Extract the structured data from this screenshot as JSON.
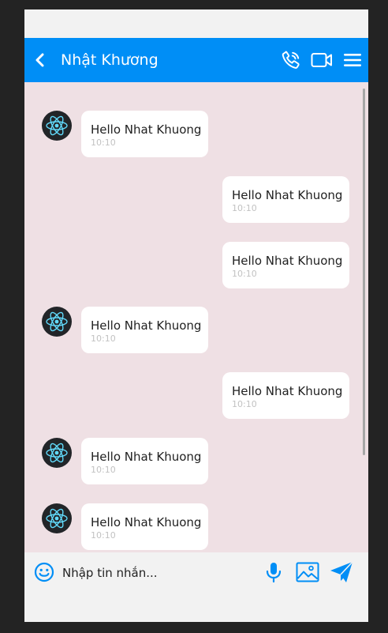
{
  "header": {
    "title": "Nhật Khương",
    "icons": [
      "back-chevron-icon",
      "phone-icon",
      "video-camera-icon",
      "menu-icon"
    ]
  },
  "messages": [
    {
      "side": "received",
      "text": "Hello Nhat Khuong",
      "time": "10:10"
    },
    {
      "side": "sent",
      "text": "Hello Nhat Khuong",
      "time": "10:10"
    },
    {
      "side": "sent",
      "text": "Hello Nhat Khuong",
      "time": "10:10"
    },
    {
      "side": "received",
      "text": "Hello Nhat Khuong",
      "time": "10:10"
    },
    {
      "side": "sent",
      "text": "Hello Nhat Khuong",
      "time": "10:10"
    },
    {
      "side": "received",
      "text": "Hello Nhat Khuong",
      "time": "10:10"
    },
    {
      "side": "received",
      "text": "Hello Nhat Khuong",
      "time": "10:10"
    }
  ],
  "composer": {
    "placeholder": "Nhập tin nhắn...",
    "icons": [
      "emoji-icon",
      "microphone-icon",
      "image-icon",
      "send-icon"
    ]
  },
  "colors": {
    "accent": "#008ef6",
    "chat_background": "#efe0e4",
    "avatar_logo": "#61dafb"
  }
}
